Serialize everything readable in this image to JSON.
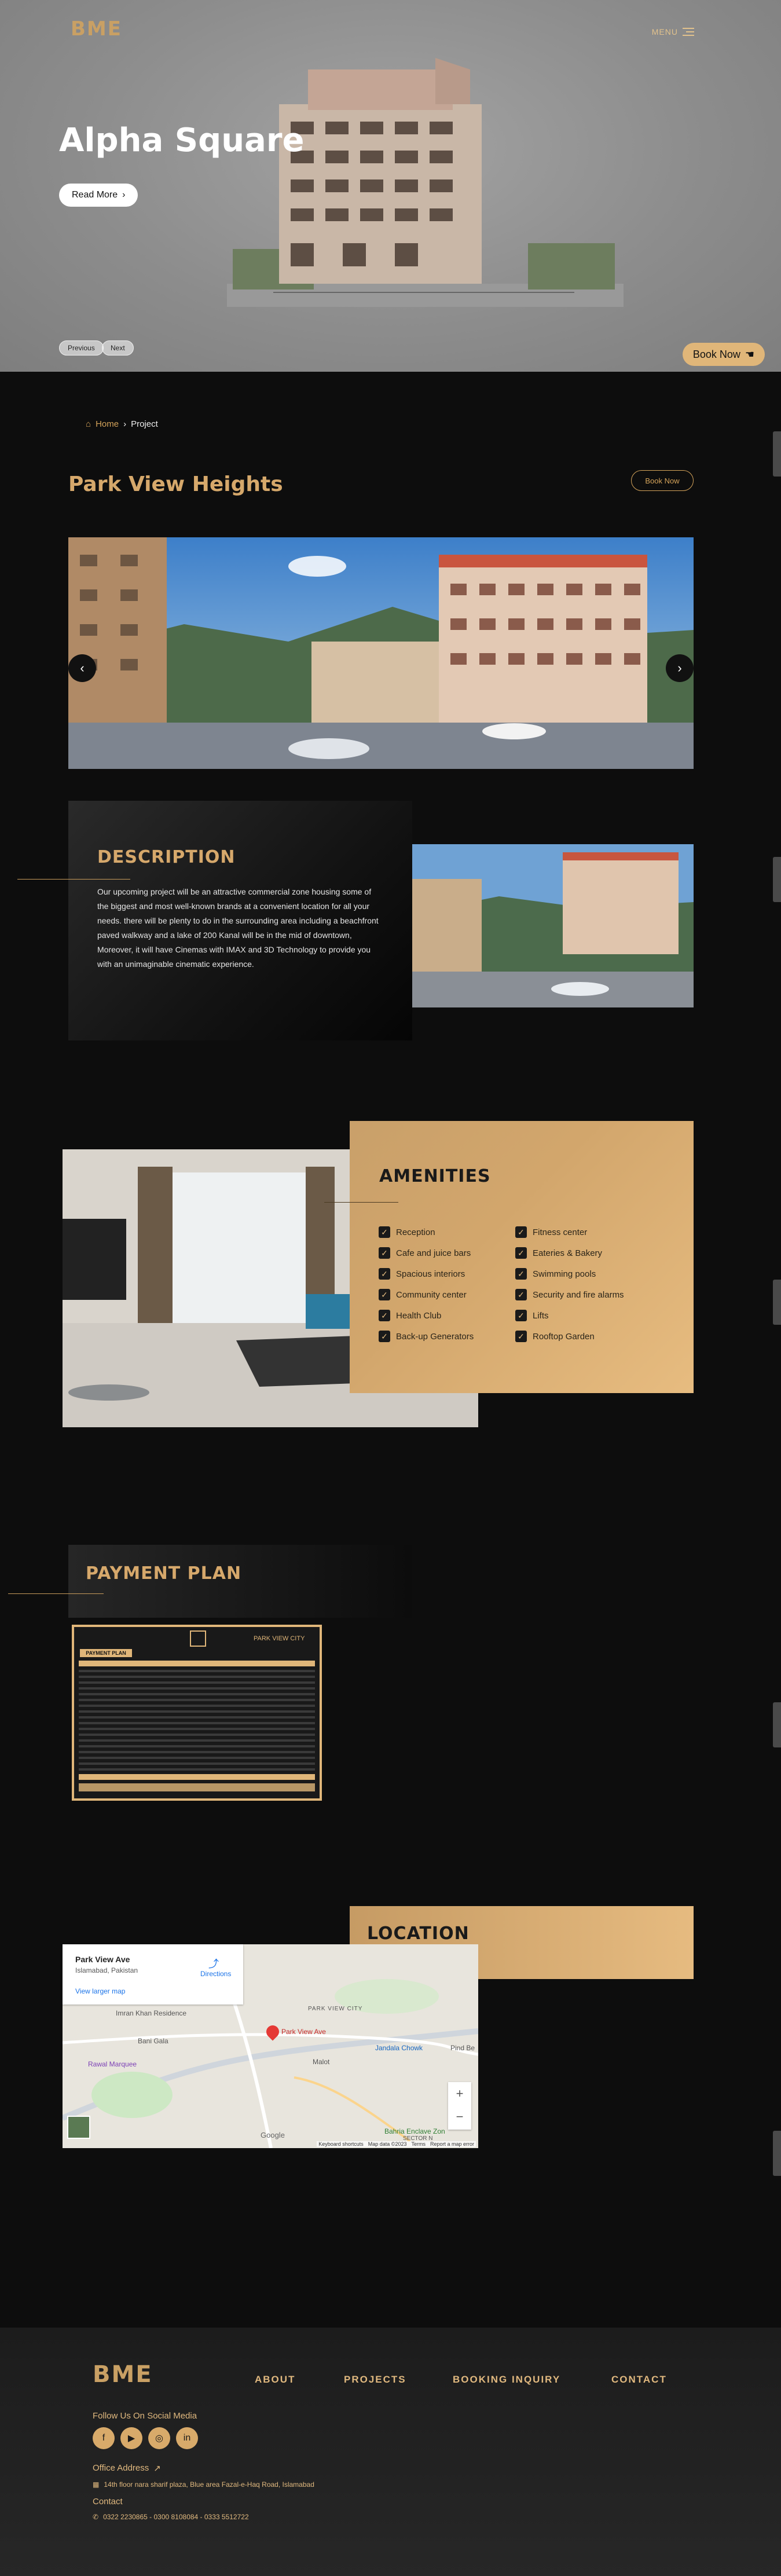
{
  "colors": {
    "gold": "#d6a86b",
    "background": "#0d0d0d",
    "hero_gray": "#8e8e8e"
  },
  "header": {
    "logo": "BME",
    "menu_label": "MENU"
  },
  "hero": {
    "title": "Alpha Square",
    "read_more": "Read More",
    "prev": "Previous",
    "next": "Next",
    "book_now": "Book Now"
  },
  "breadcrumb": {
    "home": "Home",
    "current": "Project"
  },
  "project": {
    "title": "Park View Heights",
    "book_now": "Book Now"
  },
  "description": {
    "heading": "DESCRIPTION",
    "text": "Our upcoming project will be an attractive commercial zone housing some of the biggest and most well-known brands at a convenient location for all your needs. there will be plenty to do in the surrounding area including a beachfront paved walkway and a lake of 200 Kanal will be in the mid of downtown, Moreover, it will have Cinemas with IMAX and 3D Technology to provide you with an unimaginable cinematic experience."
  },
  "amenities": {
    "heading": "AMENITIES",
    "left": [
      "Reception",
      "Cafe and juice bars",
      "Spacious interiors",
      "Community center",
      "Health Club",
      "Back-up Generators"
    ],
    "right": [
      "Fitness center",
      "Eateries & Bakery",
      "Swimming pools",
      "Security and fire alarms",
      "Lifts",
      "Rooftop Garden"
    ]
  },
  "payment": {
    "heading": "PAYMENT PLAN",
    "sheet_title": "PAYMENT PLAN",
    "sheet_brand": "PARK VIEW CITY"
  },
  "location": {
    "heading": "LOCATION",
    "map": {
      "place": "Park View Ave",
      "address": "Islamabad, Pakistan",
      "larger_map": "View larger map",
      "directions": "Directions",
      "pin_label": "Park View Ave",
      "labels": [
        "Imran Khan Residence",
        "Bani Gala",
        "Rawal Marquee",
        "Malot",
        "Jandala Chowk",
        "PARK VIEW CITY",
        "Bahria Enclave Zon",
        "SECTOR N",
        "Pind Be"
      ],
      "footer": [
        "Keyboard shortcuts",
        "Map data ©2023",
        "Terms",
        "Report a map error"
      ],
      "google": "Google"
    }
  },
  "footer": {
    "logo": "BME",
    "nav": [
      "ABOUT",
      "PROJECTS",
      "BOOKING INQUIRY",
      "CONTACT"
    ],
    "social_heading": "Follow Us On Social Media",
    "social_icons": [
      "facebook-icon",
      "youtube-icon",
      "instagram-icon",
      "linkedin-icon"
    ],
    "office_heading": "Office Address",
    "address": "14th floor nara sharif plaza, Blue area Fazal-e-Haq Road, Islamabad",
    "contact_heading": "Contact",
    "phones": "0322 2230865 - 0300 8108084 - 0333 5512722"
  }
}
